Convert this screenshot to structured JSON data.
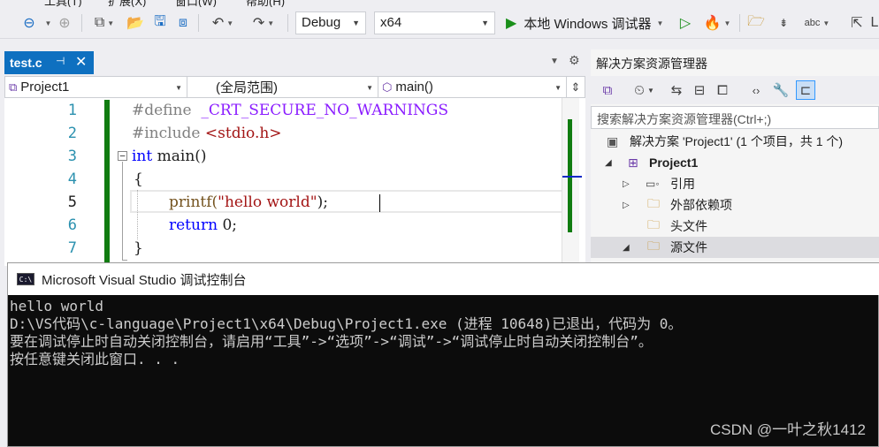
{
  "menubar": {
    "items": [
      "工具(T)",
      "扩展(X)",
      "窗口(W)",
      "帮助(H)"
    ]
  },
  "toolbar": {
    "config": "Debug",
    "platform": "x64",
    "run_label": "本地 Windows 调试器",
    "icons": [
      "back-icon",
      "forward-icon",
      "new-item-icon",
      "open-icon",
      "save-icon",
      "save-all-icon",
      "undo-icon",
      "redo-icon",
      "start-without-debug-icon",
      "hot-reload-icon",
      "solution-explorer-icon",
      "align-icon",
      "spell-icon",
      "next-icon"
    ],
    "right_cut": "L"
  },
  "doc_tab": {
    "name": "test.c",
    "pin": "⊣",
    "close": "✕"
  },
  "navbar": {
    "project": "Project1",
    "scope": "(全局范围)",
    "member": "main()"
  },
  "editor": {
    "line_numbers": [
      "1",
      "2",
      "3",
      "4",
      "5",
      "6",
      "7"
    ],
    "active_line": "5",
    "lines": {
      "l1_pre": "#define",
      "l1_macro": "_CRT_SECURE_NO_WARNINGS",
      "l2_pre": "#include",
      "l2_inc": "<stdio.h>",
      "l3_kw": "int",
      "l3_fn": "main()",
      "l4": "{",
      "l5_fn": "printf(",
      "l5_str": "\"hello world\"",
      "l5_end": ");",
      "l6_kw": "return",
      "l6_val": "0;",
      "l7": "}"
    }
  },
  "solution_explorer": {
    "title": "解决方案资源管理器",
    "search_placeholder": "搜索解决方案资源管理器(Ctrl+;)",
    "tree": {
      "solution": "解决方案 'Project1' (1 个项目，共 1 个)",
      "project": "Project1",
      "references": "引用",
      "external_deps": "外部依赖项",
      "header_files": "头文件",
      "source_files": "源文件"
    }
  },
  "console": {
    "title": "Microsoft Visual Studio 调试控制台",
    "icon_text": "C:\\",
    "lines": [
      "hello world",
      "D:\\VS代码\\c-language\\Project1\\x64\\Debug\\Project1.exe (进程 10648)已退出，代码为 0。",
      "要在调试停止时自动关闭控制台，请启用“工具”->“选项”->“调试”->“调试停止时自动关闭控制台”。",
      "按任意键关闭此窗口. . ."
    ]
  },
  "watermark": "CSDN @一叶之秋1412"
}
